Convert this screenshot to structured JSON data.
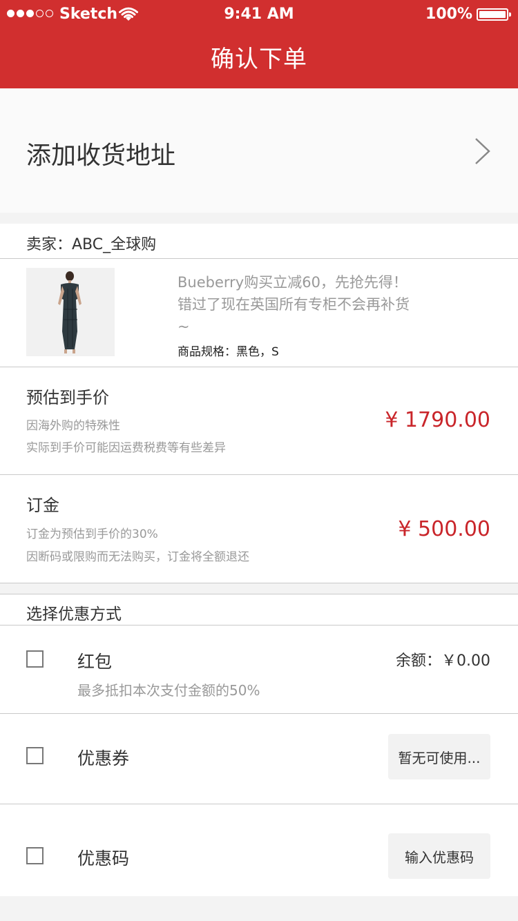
{
  "status_bar": {
    "carrier": "Sketch",
    "time": "9:41 AM",
    "battery": "100%"
  },
  "header": {
    "title": "确认下单"
  },
  "address": {
    "label": "添加收货地址"
  },
  "seller": {
    "label": "卖家：ABC_全球购"
  },
  "product": {
    "description": "Bueberry购买立减60，先抢先得！错过了现在英国所有专柜不会再补货~",
    "spec": "商品规格：黑色，S"
  },
  "estimated_price": {
    "title": "预估到手价",
    "note1": "因海外购的特殊性",
    "note2": "实际到手价可能因运费税费等有些差异",
    "amount": "¥ 1790.00"
  },
  "deposit": {
    "title": "订金",
    "note1": "订金为预估到手价的30%",
    "note2": "因断码或限购而无法购买，订金将全额退还",
    "amount": "¥ 500.00"
  },
  "discount": {
    "title": "选择优惠方式",
    "red_packet": {
      "label": "红包",
      "sub": "最多抵扣本次支付金额的50%",
      "balance": "余额：￥0.00"
    },
    "coupon": {
      "label": "优惠券",
      "button": "暂无可使用..."
    },
    "promo_code": {
      "label": "优惠码",
      "button": "输入优惠码"
    }
  },
  "colors": {
    "brand": "#d12f2f",
    "price": "#c9252a"
  }
}
